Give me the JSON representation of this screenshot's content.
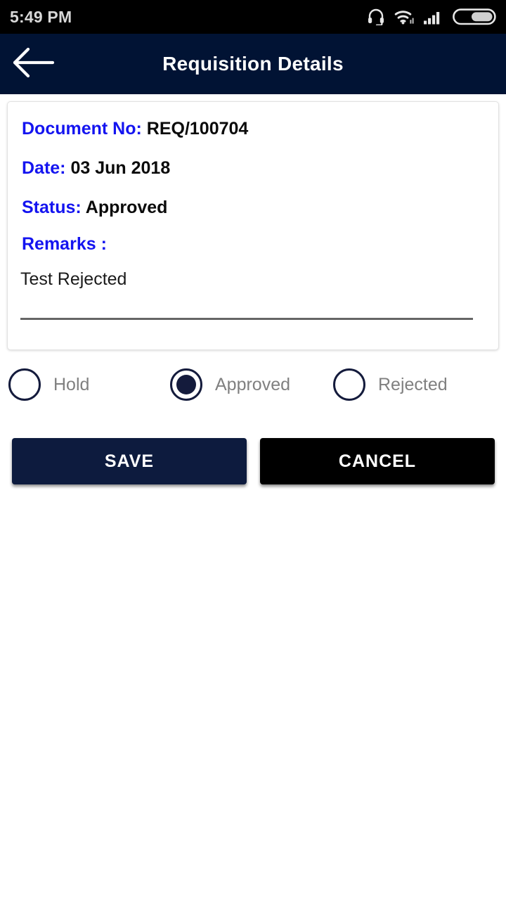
{
  "status_bar": {
    "time": "5:49 PM",
    "icons": [
      "headset-icon",
      "wifi-icon",
      "signal-icon",
      "battery-icon"
    ],
    "battery_level_percent": 55,
    "text_color": "#d8d8d8",
    "background": "#000000"
  },
  "app_bar": {
    "title": "Requisition Details",
    "back_icon": "back-arrow-icon",
    "background": "#011334",
    "title_color": "#ffffff"
  },
  "card": {
    "fields": [
      {
        "label": "Document No:",
        "value": "REQ/100704"
      },
      {
        "label": "Date:",
        "value": "03 Jun 2018"
      },
      {
        "label": "Status:",
        "value": "Approved"
      },
      {
        "label": "Remarks :",
        "value": ""
      }
    ],
    "remarks_value": "Test Rejected",
    "label_color": "#1414f0",
    "value_color": "#0b0b0b",
    "border_color": "#e2e2e2"
  },
  "radio_group": {
    "selected": "Approved",
    "options": [
      {
        "label": "Hold",
        "checked": false
      },
      {
        "label": "Approved",
        "checked": true
      },
      {
        "label": "Rejected",
        "checked": false
      }
    ],
    "ring_color": "#141b3c",
    "label_color": "#808080"
  },
  "actions": {
    "save_label": "SAVE",
    "cancel_label": "CANCEL",
    "save_color": "#0d1b3e",
    "cancel_color": "#000000"
  }
}
